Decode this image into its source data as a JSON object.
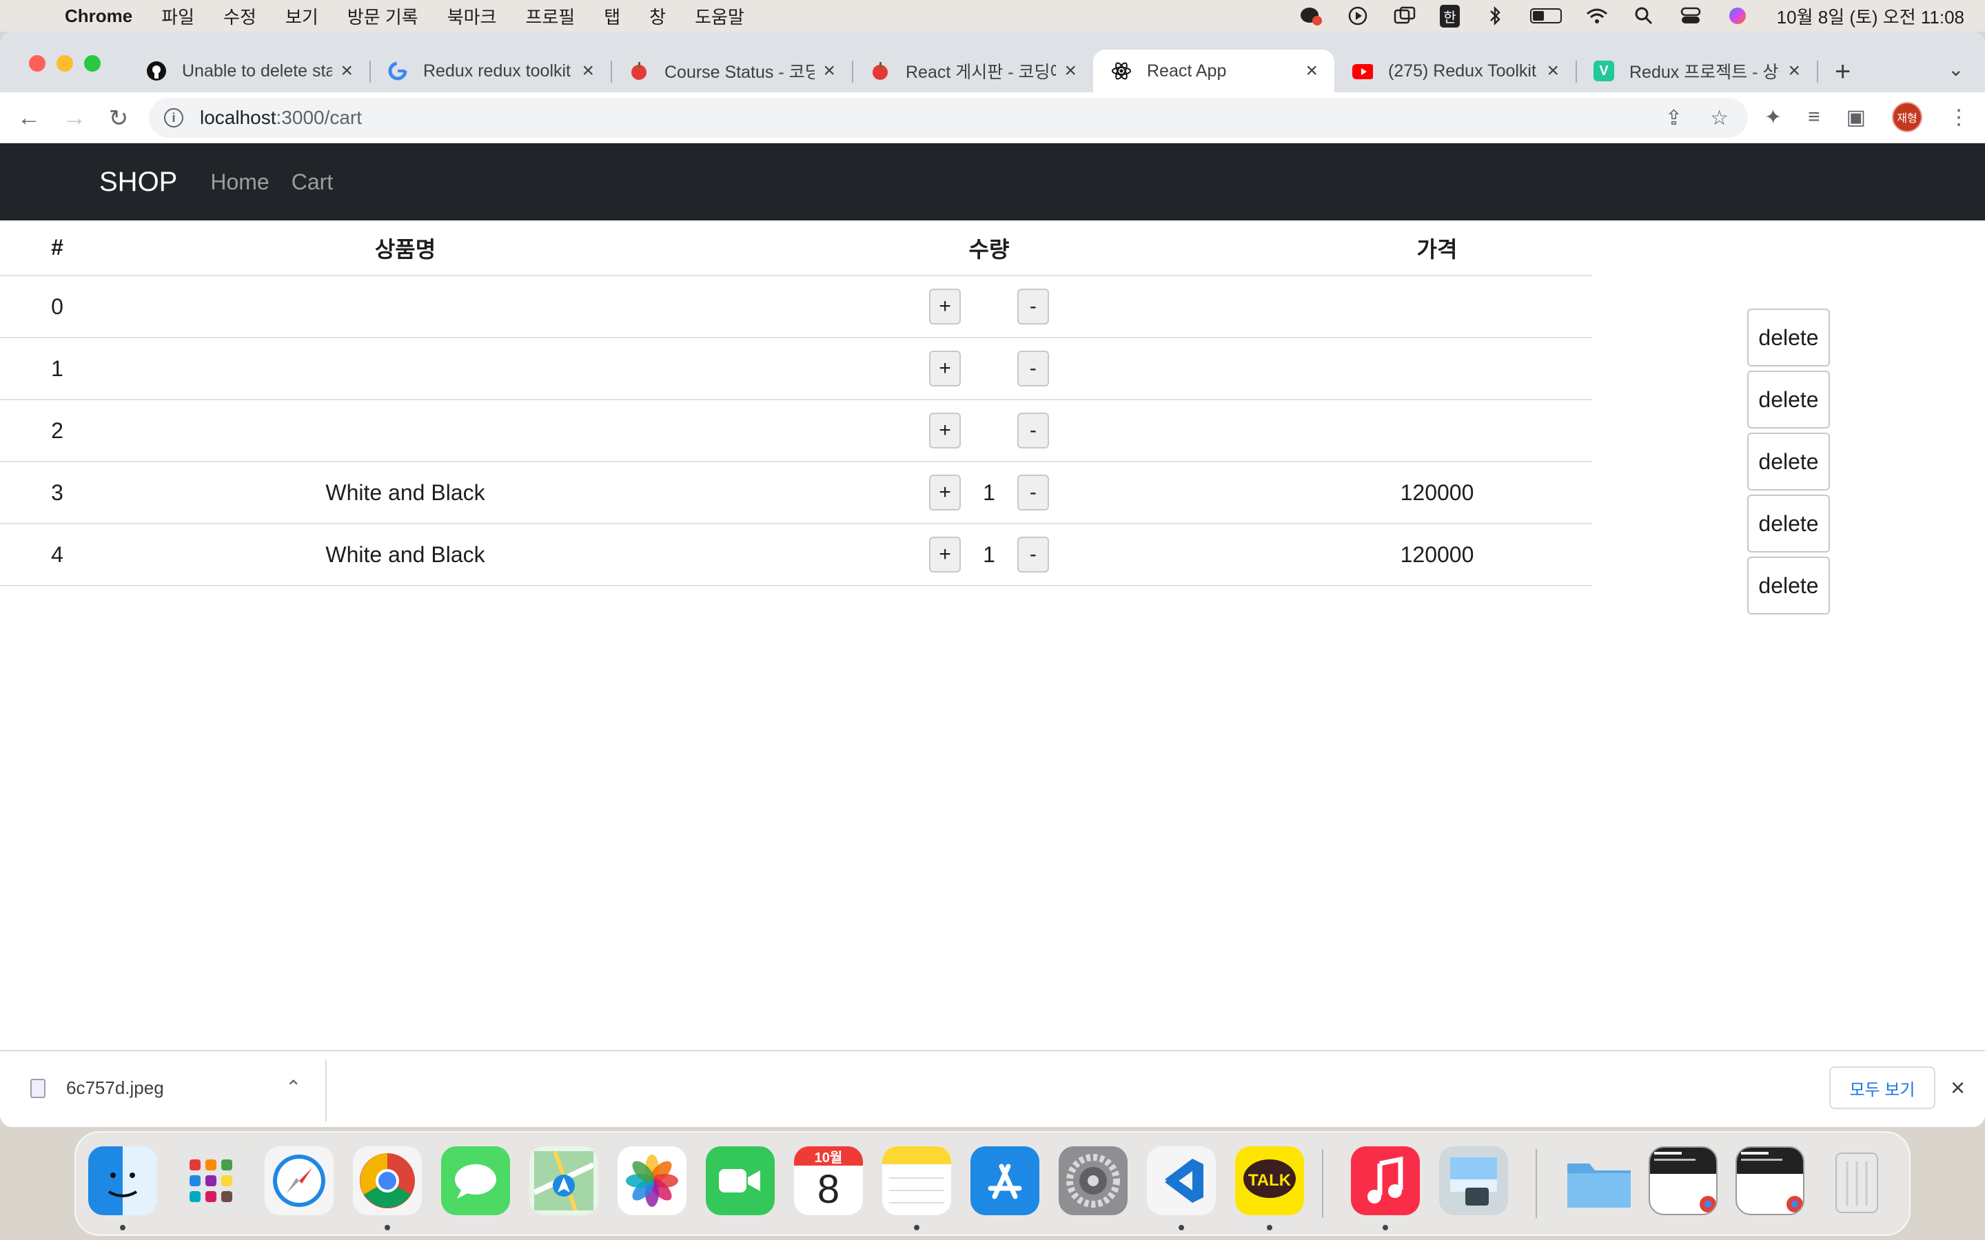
{
  "menubar": {
    "app": "Chrome",
    "items": [
      "파일",
      "수정",
      "보기",
      "방문 기록",
      "북마크",
      "프로필",
      "탭",
      "창",
      "도움말"
    ],
    "input_method": "한",
    "clock": "10월 8일 (토) 오전 11:08"
  },
  "tabs": [
    {
      "title": "Unable to delete sta",
      "icon": "github-icon"
    },
    {
      "title": "Redux redux toolkit",
      "icon": "google-icon"
    },
    {
      "title": "Course Status - 코딩",
      "icon": "apple-icon"
    },
    {
      "title": "React 게시판 - 코딩애",
      "icon": "apple-icon"
    },
    {
      "title": "React App",
      "icon": "react-icon",
      "active": true
    },
    {
      "title": "(275) Redux Toolkit",
      "icon": "youtube-icon"
    },
    {
      "title": "Redux 프로젝트 - 상품",
      "icon": "velog-icon"
    }
  ],
  "address": {
    "host": "localhost",
    "path": ":3000/cart"
  },
  "profile_initials": "재형",
  "navbar": {
    "brand": "SHOP",
    "links": [
      "Home",
      "Cart"
    ]
  },
  "table": {
    "headers": [
      "#",
      "상품명",
      "수량",
      "가격"
    ],
    "rows": [
      {
        "id": "0",
        "name": "",
        "count": "",
        "price": ""
      },
      {
        "id": "1",
        "name": "",
        "count": "",
        "price": ""
      },
      {
        "id": "2",
        "name": "",
        "count": "",
        "price": ""
      },
      {
        "id": "3",
        "name": "White and Black",
        "count": "1",
        "price": "120000"
      },
      {
        "id": "4",
        "name": "White and Black",
        "count": "1",
        "price": "120000"
      }
    ],
    "plus_label": "+",
    "minus_label": "-",
    "delete_label": "delete"
  },
  "download": {
    "filename": "6c757d.jpeg",
    "show_all": "모두 보기"
  },
  "calendar": {
    "month": "10월",
    "day": "8"
  },
  "colors": {
    "navbar": "#212529",
    "accent": "#1a73e8"
  }
}
